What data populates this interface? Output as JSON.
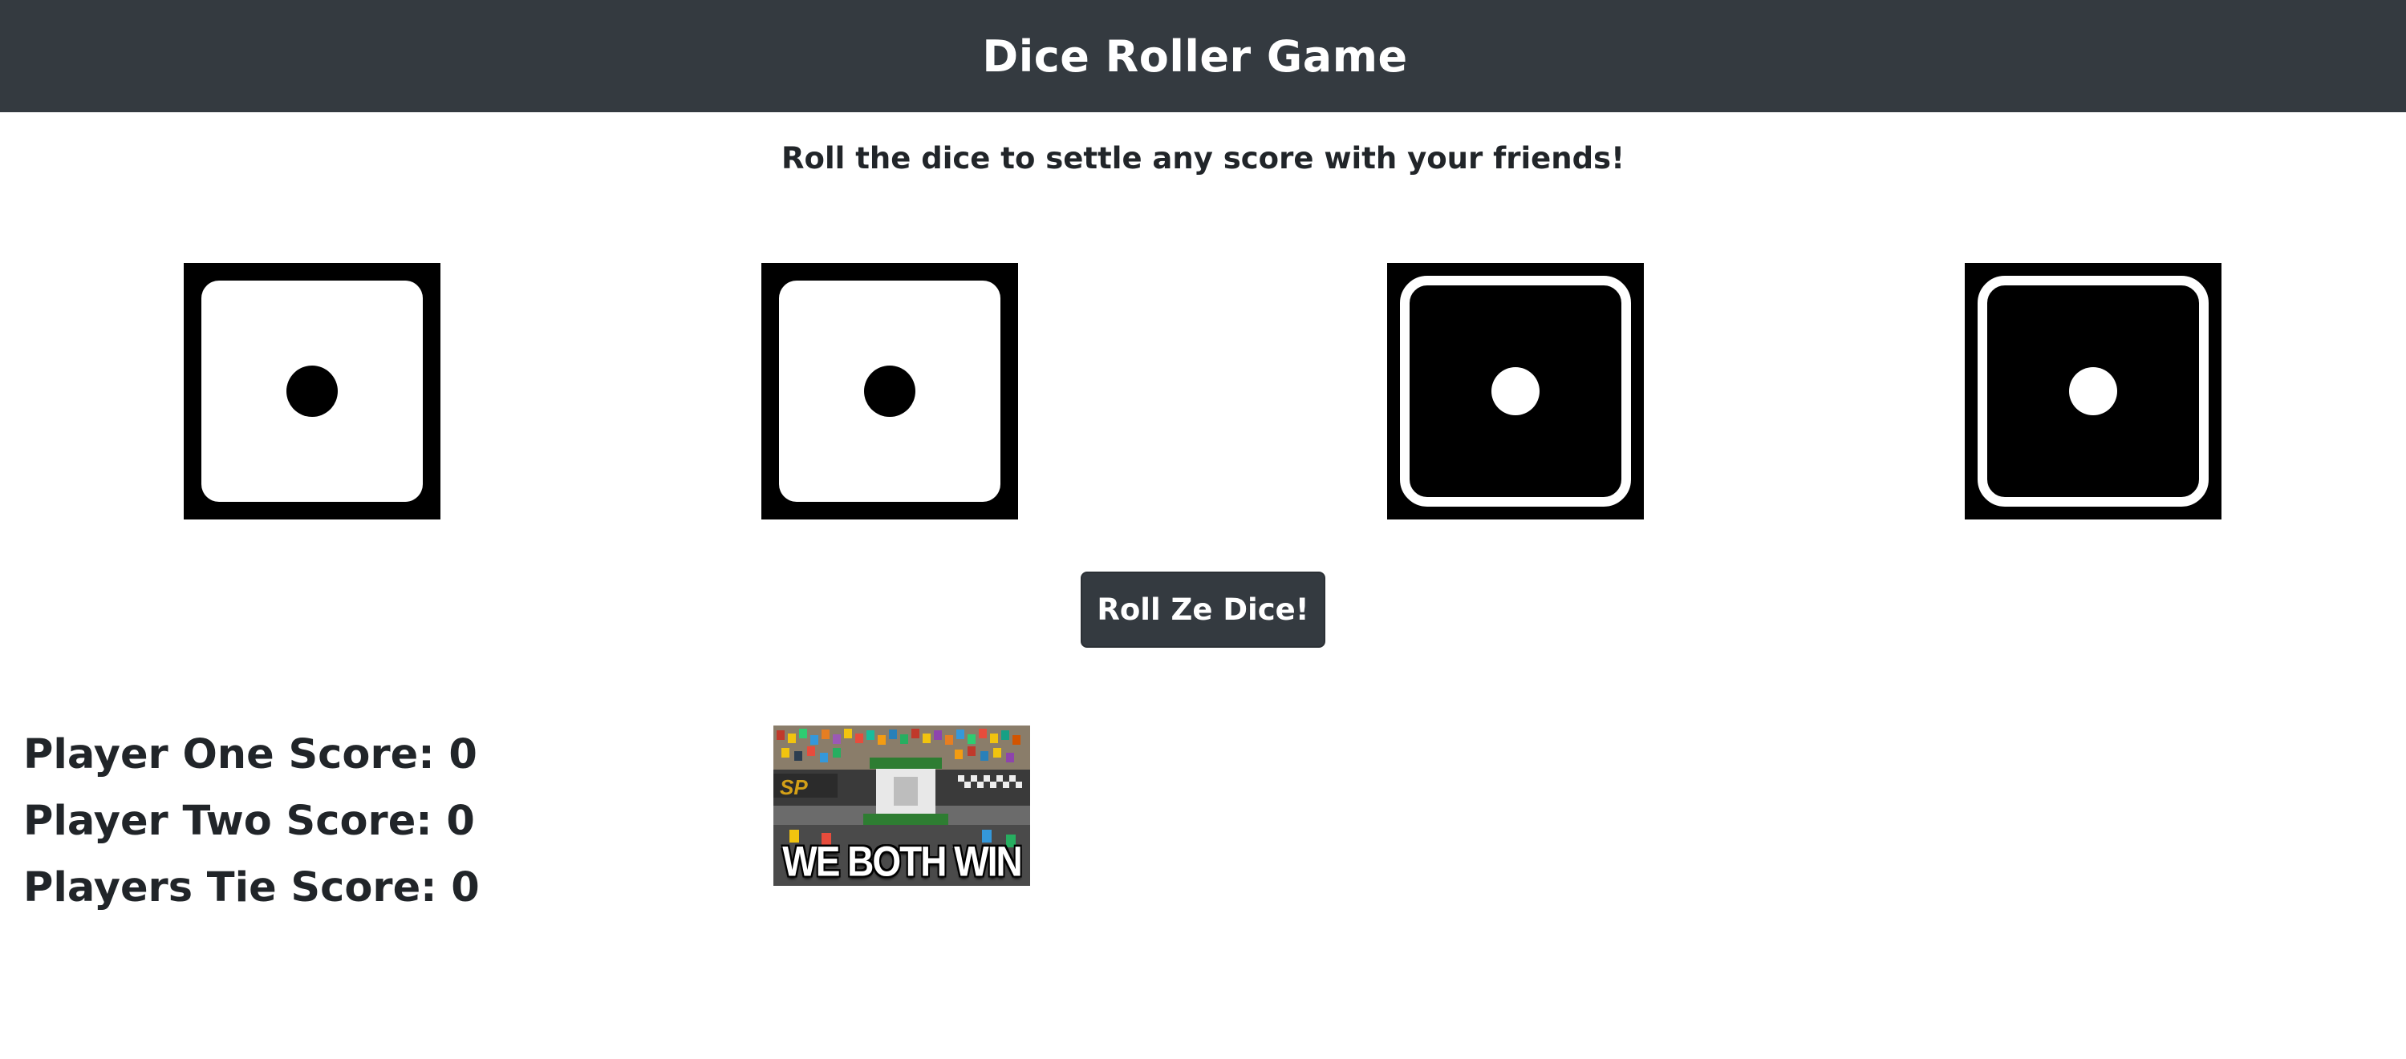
{
  "header": {
    "title": "Dice Roller Game"
  },
  "tagline": "Roll the dice to settle any score with your friends!",
  "dice": [
    {
      "value": 1,
      "style": "white",
      "icon": "die-face-1-icon"
    },
    {
      "value": 1,
      "style": "white",
      "icon": "die-face-1-icon"
    },
    {
      "value": 1,
      "style": "black",
      "icon": "die-face-1-icon"
    },
    {
      "value": 1,
      "style": "black",
      "icon": "die-face-1-icon"
    }
  ],
  "roll_button": {
    "label": "Roll Ze Dice!"
  },
  "scores": {
    "player_one": "Player One Score: 0",
    "player_two": "Player Two Score: 0",
    "tie": "Players Tie Score: 0"
  },
  "result_image": {
    "caption": "WE BOTH WIN"
  },
  "colors": {
    "navbar": "#343a40",
    "button": "#343a40",
    "text": "#212529",
    "background": "#ffffff"
  }
}
